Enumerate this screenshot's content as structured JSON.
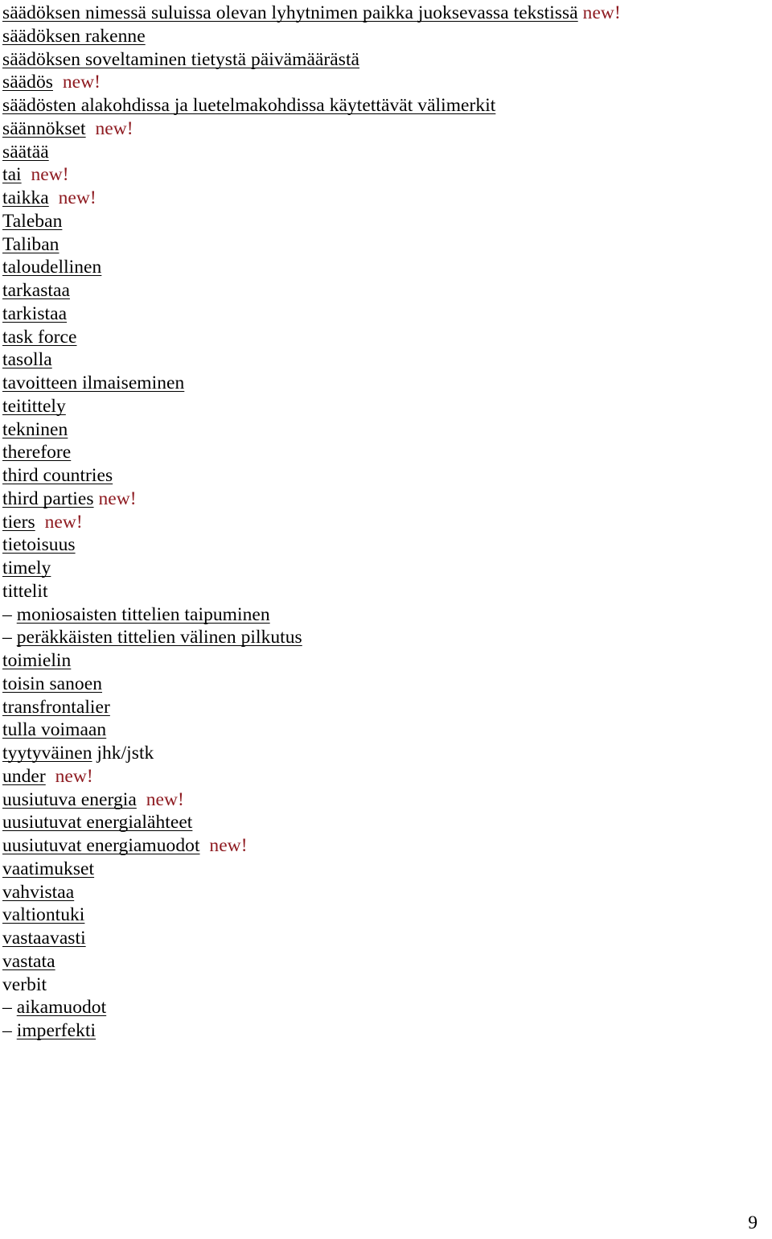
{
  "document": {
    "page_number": "9",
    "new_marker_label": "new!",
    "new_marker_color": "#8E1A20",
    "text_color": "#000000",
    "background_color": "#FFFFFF",
    "entries": [
      {
        "dash": "",
        "term": "säädöksen nimessä suluissa olevan lyhytnimen paikka juoksevassa tekstissä",
        "underlined": true,
        "suffix": "",
        "gap": " ",
        "new": true
      },
      {
        "dash": "",
        "term": "säädöksen rakenne",
        "underlined": true,
        "suffix": "",
        "gap": "",
        "new": false
      },
      {
        "dash": "",
        "term": "säädöksen soveltaminen tietystä päivämäärästä",
        "underlined": true,
        "suffix": "",
        "gap": "",
        "new": false
      },
      {
        "dash": "",
        "term": "säädös",
        "underlined": true,
        "suffix": "",
        "gap": "  ",
        "new": true
      },
      {
        "dash": "",
        "term": "säädösten alakohdissa ja luetelmakohdissa käytettävät välimerkit",
        "underlined": true,
        "suffix": "",
        "gap": "",
        "new": false
      },
      {
        "dash": "",
        "term": "säännökset",
        "underlined": true,
        "suffix": "",
        "gap": "  ",
        "new": true
      },
      {
        "dash": "",
        "term": "säätää",
        "underlined": true,
        "suffix": "",
        "gap": "",
        "new": false
      },
      {
        "dash": "",
        "term": "tai",
        "underlined": true,
        "suffix": "",
        "gap": "  ",
        "new": true
      },
      {
        "dash": "",
        "term": "taikka",
        "underlined": true,
        "suffix": "",
        "gap": "  ",
        "new": true
      },
      {
        "dash": "",
        "term": "Taleban",
        "underlined": true,
        "suffix": "",
        "gap": "",
        "new": false
      },
      {
        "dash": "",
        "term": "Taliban",
        "underlined": true,
        "suffix": "",
        "gap": "",
        "new": false
      },
      {
        "dash": "",
        "term": "taloudellinen",
        "underlined": true,
        "suffix": "",
        "gap": "",
        "new": false
      },
      {
        "dash": "",
        "term": "tarkastaa",
        "underlined": true,
        "suffix": "",
        "gap": "",
        "new": false
      },
      {
        "dash": "",
        "term": "tarkistaa",
        "underlined": true,
        "suffix": "",
        "gap": "",
        "new": false
      },
      {
        "dash": "",
        "term": "task force",
        "underlined": true,
        "suffix": "",
        "gap": "",
        "new": false
      },
      {
        "dash": "",
        "term": "tasolla",
        "underlined": true,
        "suffix": "",
        "gap": "",
        "new": false
      },
      {
        "dash": "",
        "term": "tavoitteen ilmaiseminen",
        "underlined": true,
        "suffix": "",
        "gap": "",
        "new": false
      },
      {
        "dash": "",
        "term": "teitittely",
        "underlined": true,
        "suffix": "",
        "gap": "",
        "new": false
      },
      {
        "dash": "",
        "term": "tekninen",
        "underlined": true,
        "suffix": "",
        "gap": "",
        "new": false
      },
      {
        "dash": "",
        "term": "therefore",
        "underlined": true,
        "suffix": "",
        "gap": "",
        "new": false
      },
      {
        "dash": "",
        "term": "third countries",
        "underlined": true,
        "suffix": "",
        "gap": "",
        "new": false
      },
      {
        "dash": "",
        "term": "third parties",
        "underlined": true,
        "suffix": "",
        "gap": " ",
        "new": true
      },
      {
        "dash": "",
        "term": "tiers",
        "underlined": true,
        "suffix": "",
        "gap": "  ",
        "new": true
      },
      {
        "dash": "",
        "term": "tietoisuus",
        "underlined": true,
        "suffix": "",
        "gap": "",
        "new": false
      },
      {
        "dash": "",
        "term": "timely",
        "underlined": true,
        "suffix": "",
        "gap": "",
        "new": false
      },
      {
        "dash": "",
        "term": "tittelit",
        "underlined": false,
        "suffix": "",
        "gap": "",
        "new": false
      },
      {
        "dash": "– ",
        "term": "moniosaisten tittelien taipuminen",
        "underlined": true,
        "suffix": "",
        "gap": "",
        "new": false
      },
      {
        "dash": "– ",
        "term": "peräkkäisten tittelien välinen pilkutus",
        "underlined": true,
        "suffix": "",
        "gap": "",
        "new": false
      },
      {
        "dash": "",
        "term": "toimielin",
        "underlined": true,
        "suffix": "",
        "gap": "",
        "new": false
      },
      {
        "dash": "",
        "term": "toisin sanoen",
        "underlined": true,
        "suffix": "",
        "gap": "",
        "new": false
      },
      {
        "dash": "",
        "term": "transfrontalier",
        "underlined": true,
        "suffix": "",
        "gap": "",
        "new": false
      },
      {
        "dash": "",
        "term": "tulla voimaan",
        "underlined": true,
        "suffix": "",
        "gap": "",
        "new": false
      },
      {
        "dash": "",
        "term": "tyytyväinen",
        "underlined": true,
        "suffix": " jhk/jstk",
        "gap": "",
        "new": false
      },
      {
        "dash": "",
        "term": "under",
        "underlined": true,
        "suffix": "",
        "gap": "  ",
        "new": true
      },
      {
        "dash": "",
        "term": "uusiutuva energia",
        "underlined": true,
        "suffix": "",
        "gap": "  ",
        "new": true
      },
      {
        "dash": "",
        "term": "uusiutuvat energialähteet",
        "underlined": true,
        "suffix": "",
        "gap": "",
        "new": false
      },
      {
        "dash": "",
        "term": "uusiutuvat energiamuodot",
        "underlined": true,
        "suffix": "",
        "gap": "  ",
        "new": true
      },
      {
        "dash": "",
        "term": "vaatimukset",
        "underlined": true,
        "suffix": "",
        "gap": "",
        "new": false
      },
      {
        "dash": "",
        "term": "vahvistaa",
        "underlined": true,
        "suffix": "",
        "gap": "",
        "new": false
      },
      {
        "dash": "",
        "term": "valtiontuki",
        "underlined": true,
        "suffix": "",
        "gap": "",
        "new": false
      },
      {
        "dash": "",
        "term": "vastaavasti",
        "underlined": true,
        "suffix": "",
        "gap": "",
        "new": false
      },
      {
        "dash": "",
        "term": "vastata",
        "underlined": true,
        "suffix": "",
        "gap": "",
        "new": false
      },
      {
        "dash": "",
        "term": "verbit",
        "underlined": false,
        "suffix": "",
        "gap": "",
        "new": false
      },
      {
        "dash": "– ",
        "term": "aikamuodot",
        "underlined": true,
        "suffix": "",
        "gap": "",
        "new": false
      },
      {
        "dash": "– ",
        "term": "imperfekti",
        "underlined": true,
        "suffix": "",
        "gap": "",
        "new": false
      }
    ]
  }
}
